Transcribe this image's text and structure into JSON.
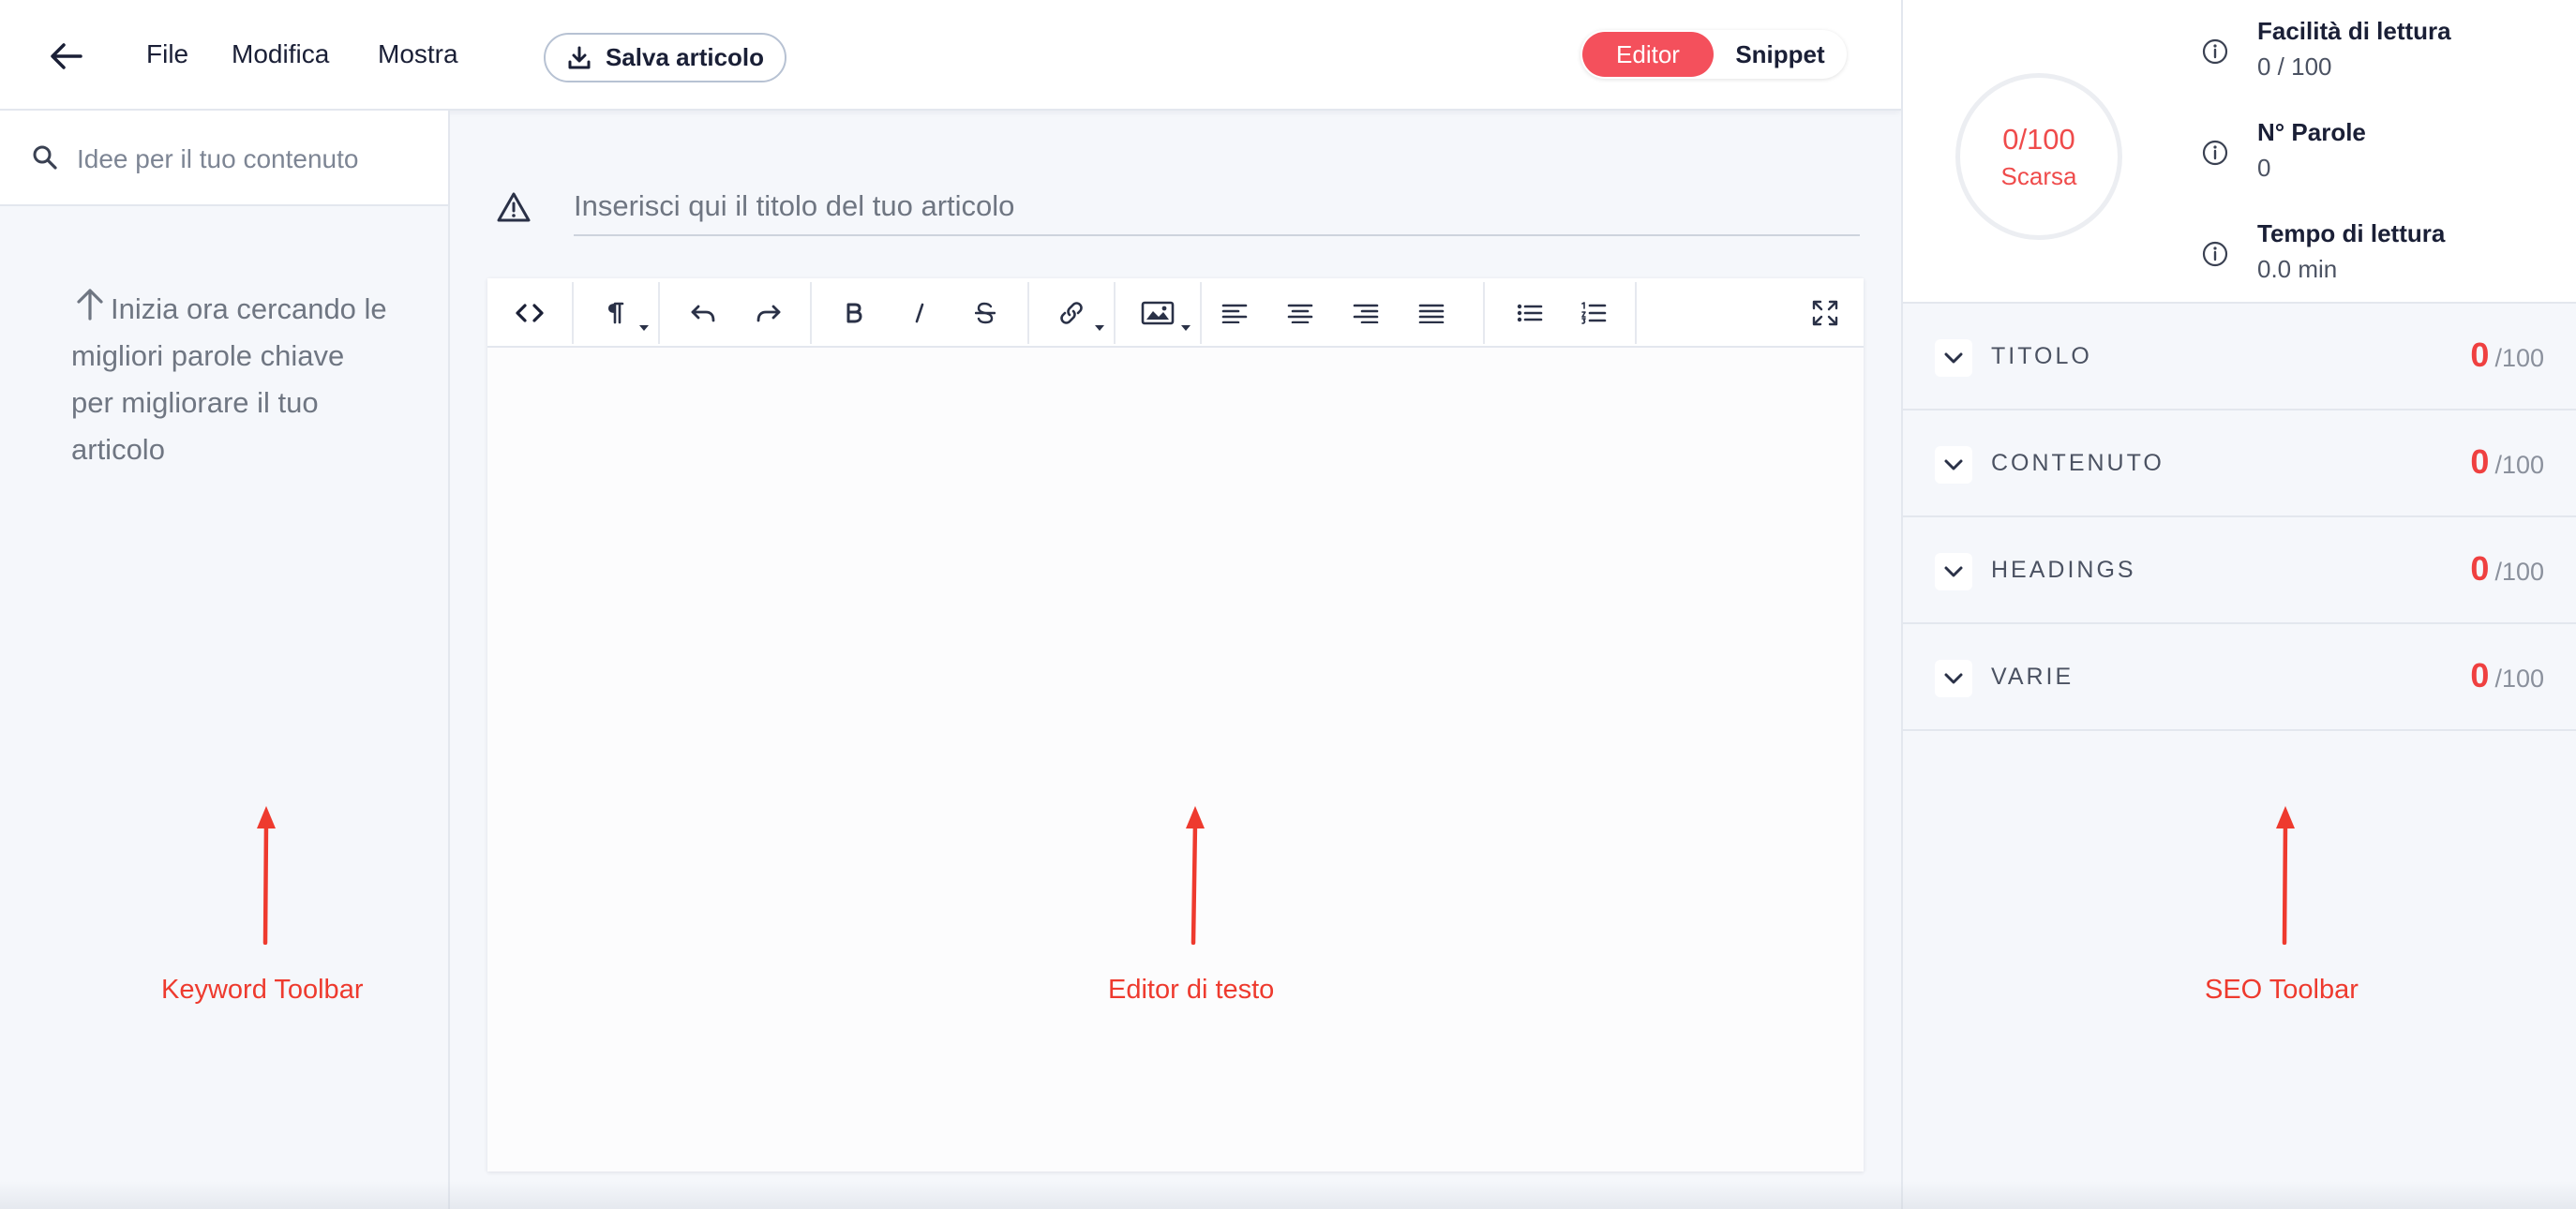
{
  "topbar": {
    "menu": [
      "File",
      "Modifica",
      "Mostra"
    ],
    "save_label": "Salva articolo",
    "toggle": {
      "editor": "Editor",
      "snippet": "Snippet",
      "active": "Editor"
    }
  },
  "keywords": {
    "search_placeholder": "Idee per il tuo contenuto",
    "hint": "Inizia ora cercando le migliori parole chiave per migliorare il tuo articolo"
  },
  "editor": {
    "title_placeholder": "Inserisci qui il titolo del tuo articolo",
    "toolbar_icons": [
      "code-view-icon",
      "paragraph-icon",
      "undo-icon",
      "redo-icon",
      "bold-icon",
      "italic-icon",
      "strikethrough-icon",
      "link-icon",
      "image-icon",
      "align-left-icon",
      "align-center-icon",
      "align-right-icon",
      "align-justify-icon",
      "bullet-list-icon",
      "numbered-list-icon",
      "fullscreen-icon"
    ]
  },
  "seo": {
    "score": "0/100",
    "score_label": "Scarsa",
    "metrics": [
      {
        "title": "Facilità di lettura",
        "value": "0 / 100"
      },
      {
        "title": "N° Parole",
        "value": "0"
      },
      {
        "title": "Tempo di lettura",
        "value": "0.0 min"
      }
    ],
    "sections": [
      {
        "label": "TITOLO",
        "score": "0",
        "max": "/100"
      },
      {
        "label": "CONTENUTO",
        "score": "0",
        "max": "/100"
      },
      {
        "label": "HEADINGS",
        "score": "0",
        "max": "/100"
      },
      {
        "label": "VARIE",
        "score": "0",
        "max": "/100"
      }
    ]
  },
  "annotations": {
    "keyword_toolbar": "Keyword Toolbar",
    "editor": "Editor di testo",
    "seo_toolbar": "SEO Toolbar"
  },
  "colors": {
    "accent": "#f4505c",
    "score_red": "#ef4040",
    "annotation": "#ee3a2e",
    "panel_bg": "#f5f7fb"
  }
}
